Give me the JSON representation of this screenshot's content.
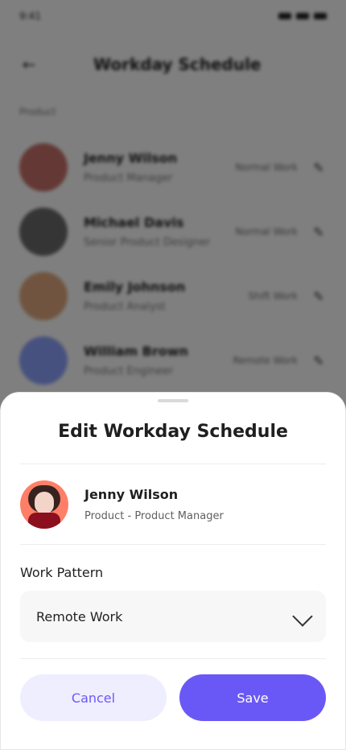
{
  "status": {
    "time": "9:41"
  },
  "header": {
    "title": "Workday Schedule"
  },
  "list": {
    "section_label": "Product",
    "items": [
      {
        "name": "Jenny Wilson",
        "role": "Product Manager",
        "pattern": "Normal Work",
        "avatar_color": "#c8726a"
      },
      {
        "name": "Michael Davis",
        "role": "Senior Product Designer",
        "pattern": "Normal Work",
        "avatar_color": "#6b6b6b"
      },
      {
        "name": "Emily Johnson",
        "role": "Product Analyst",
        "pattern": "Shift Work",
        "avatar_color": "#e1a97e"
      },
      {
        "name": "William Brown",
        "role": "Product Engineer",
        "pattern": "Remote Work",
        "avatar_color": "#8ea3ff"
      }
    ]
  },
  "modal": {
    "title": "Edit Workday Schedule",
    "person": {
      "name": "Jenny Wilson",
      "role": "Product - Product Manager"
    },
    "work_pattern_label": "Work Pattern",
    "selected_pattern": "Remote Work",
    "cancel_label": "Cancel",
    "save_label": "Save"
  },
  "colors": {
    "primary": "#6A58F6",
    "primary_soft": "#EFEEFE",
    "overlay": "rgba(0,0,0,0.5)"
  }
}
